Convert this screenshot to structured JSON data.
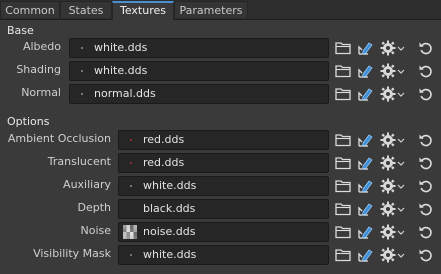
{
  "tabs": [
    {
      "label": "Common"
    },
    {
      "label": "States"
    },
    {
      "label": "Textures"
    },
    {
      "label": "Parameters"
    }
  ],
  "active_tab": "Textures",
  "sections": {
    "base": {
      "title": "Base"
    },
    "options": {
      "title": "Options"
    }
  },
  "base_rows": [
    {
      "label": "Albedo",
      "value": "white.dds",
      "swatch": "dot"
    },
    {
      "label": "Shading",
      "value": "white.dds",
      "swatch": "dot"
    },
    {
      "label": "Normal",
      "value": "normal.dds",
      "swatch": "dot"
    }
  ],
  "option_rows": [
    {
      "label": "Ambient Occlusion",
      "value": "red.dds",
      "swatch": "red-dot"
    },
    {
      "label": "Translucent",
      "value": "red.dds",
      "swatch": "red-dot"
    },
    {
      "label": "Auxiliary",
      "value": "white.dds",
      "swatch": "dot"
    },
    {
      "label": "Depth",
      "value": "black.dds",
      "swatch": "none"
    },
    {
      "label": "Noise",
      "value": "noise.dds",
      "swatch": "noise"
    },
    {
      "label": "Visibility Mask",
      "value": "white.dds",
      "swatch": "dot"
    }
  ],
  "icons": [
    "folder-icon",
    "edit-texture-icon",
    "gear-icon",
    "chevron-down-icon",
    "reset-icon"
  ],
  "colors": {
    "accent": "#4a8fcf",
    "background": "#3a3a3a",
    "field": "#262626"
  }
}
